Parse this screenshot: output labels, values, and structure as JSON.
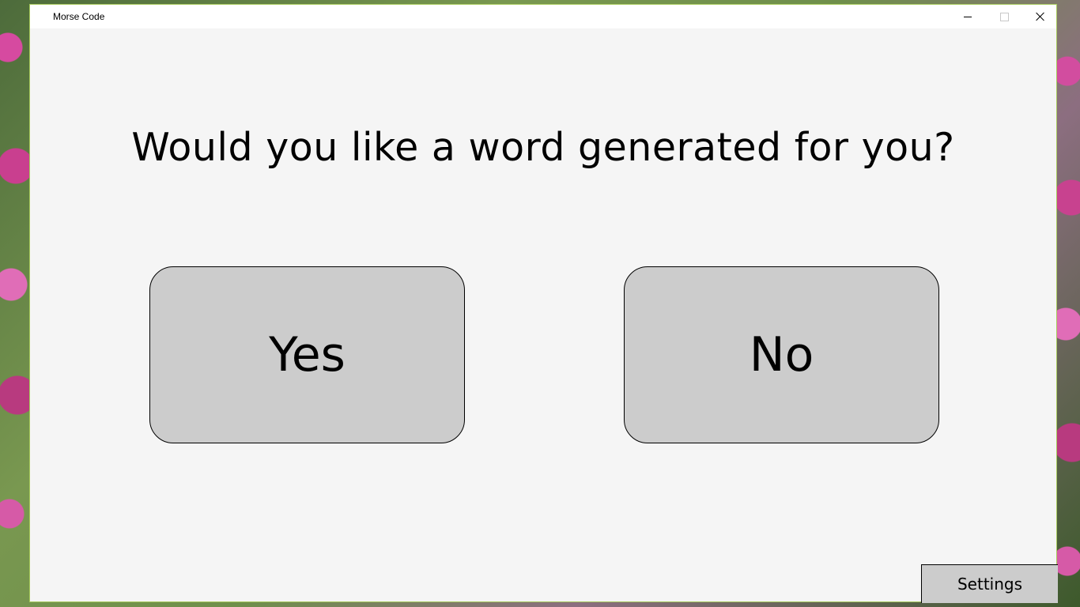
{
  "window": {
    "title": "Morse Code"
  },
  "main": {
    "question": "Would you like a word generated for you?",
    "yes_label": "Yes",
    "no_label": "No"
  },
  "footer": {
    "settings_label": "Settings"
  },
  "icons": {
    "minimize": "minimize-icon",
    "maximize": "maximize-icon",
    "close": "close-icon"
  }
}
